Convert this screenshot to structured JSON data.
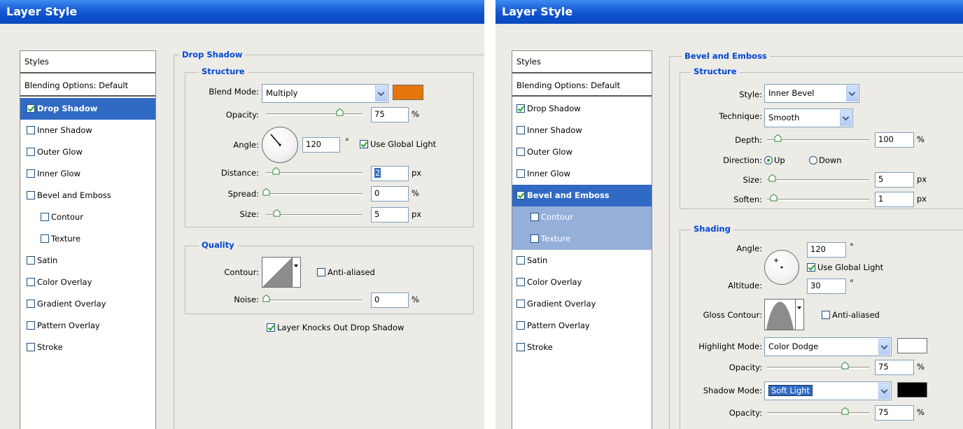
{
  "left_dialog": {
    "title": "Layer Style",
    "sidebar": {
      "header": "Styles",
      "blending": "Blending Options: Default",
      "items": [
        {
          "label": "Drop Shadow",
          "checked": true
        },
        {
          "label": "Inner Shadow",
          "checked": false
        },
        {
          "label": "Outer Glow",
          "checked": false
        },
        {
          "label": "Inner Glow",
          "checked": false
        },
        {
          "label": "Bevel and Emboss",
          "checked": false
        },
        {
          "label": "Contour",
          "checked": false
        },
        {
          "label": "Texture",
          "checked": false
        },
        {
          "label": "Satin",
          "checked": false
        },
        {
          "label": "Color Overlay",
          "checked": false
        },
        {
          "label": "Gradient Overlay",
          "checked": false
        },
        {
          "label": "Pattern Overlay",
          "checked": false
        },
        {
          "label": "Stroke",
          "checked": false
        }
      ]
    },
    "section_title": "Drop Shadow",
    "structure": {
      "title": "Structure",
      "blend_mode_label": "Blend Mode:",
      "blend_mode_value": "Multiply",
      "shadow_color": "#e7760a",
      "opacity_label": "Opacity:",
      "opacity_value": "75",
      "opacity_unit": "%",
      "angle_label": "Angle:",
      "angle_value": "120",
      "angle_unit": "°",
      "global_light_label": "Use Global Light",
      "distance_label": "Distance:",
      "distance_value": "2",
      "distance_unit": "px",
      "spread_label": "Spread:",
      "spread_value": "0",
      "spread_unit": "%",
      "size_label": "Size:",
      "size_value": "5",
      "size_unit": "px"
    },
    "quality": {
      "title": "Quality",
      "contour_label": "Contour:",
      "anti_aliased_label": "Anti-aliased",
      "noise_label": "Noise:",
      "noise_value": "0",
      "noise_unit": "%"
    },
    "knockout_label": "Layer Knocks Out Drop Shadow"
  },
  "right_dialog": {
    "title": "Layer Style",
    "sidebar": {
      "header": "Styles",
      "blending": "Blending Options: Default",
      "items": [
        {
          "label": "Drop Shadow",
          "checked": true
        },
        {
          "label": "Inner Shadow",
          "checked": false
        },
        {
          "label": "Outer Glow",
          "checked": false
        },
        {
          "label": "Inner Glow",
          "checked": false
        },
        {
          "label": "Bevel and Emboss",
          "checked": true
        },
        {
          "label": "Contour",
          "checked": false
        },
        {
          "label": "Texture",
          "checked": false
        },
        {
          "label": "Satin",
          "checked": false
        },
        {
          "label": "Color Overlay",
          "checked": false
        },
        {
          "label": "Gradient Overlay",
          "checked": false
        },
        {
          "label": "Pattern Overlay",
          "checked": false
        },
        {
          "label": "Stroke",
          "checked": false
        }
      ]
    },
    "section_title": "Bevel and Emboss",
    "structure": {
      "title": "Structure",
      "style_label": "Style:",
      "style_value": "Inner Bevel",
      "technique_label": "Technique:",
      "technique_value": "Smooth",
      "depth_label": "Depth:",
      "depth_value": "100",
      "depth_unit": "%",
      "direction_label": "Direction:",
      "direction_up": "Up",
      "direction_down": "Down",
      "size_label": "Size:",
      "size_value": "5",
      "size_unit": "px",
      "soften_label": "Soften:",
      "soften_value": "1",
      "soften_unit": "px"
    },
    "shading": {
      "title": "Shading",
      "angle_label": "Angle:",
      "angle_value": "120",
      "angle_unit": "°",
      "global_light_label": "Use Global Light",
      "altitude_label": "Altitude:",
      "altitude_value": "30",
      "altitude_unit": "°",
      "gloss_contour_label": "Gloss Contour:",
      "anti_aliased_label": "Anti-aliased",
      "highlight_mode_label": "Highlight Mode:",
      "highlight_mode_value": "Color Dodge",
      "highlight_color": "#ffffff",
      "highlight_opacity_label": "Opacity:",
      "highlight_opacity_value": "75",
      "highlight_opacity_unit": "%",
      "shadow_mode_label": "Shadow Mode:",
      "shadow_mode_value": "Soft Light",
      "shadow_color": "#000000",
      "shadow_opacity_label": "Opacity:",
      "shadow_opacity_value": "75",
      "shadow_opacity_unit": "%"
    }
  }
}
